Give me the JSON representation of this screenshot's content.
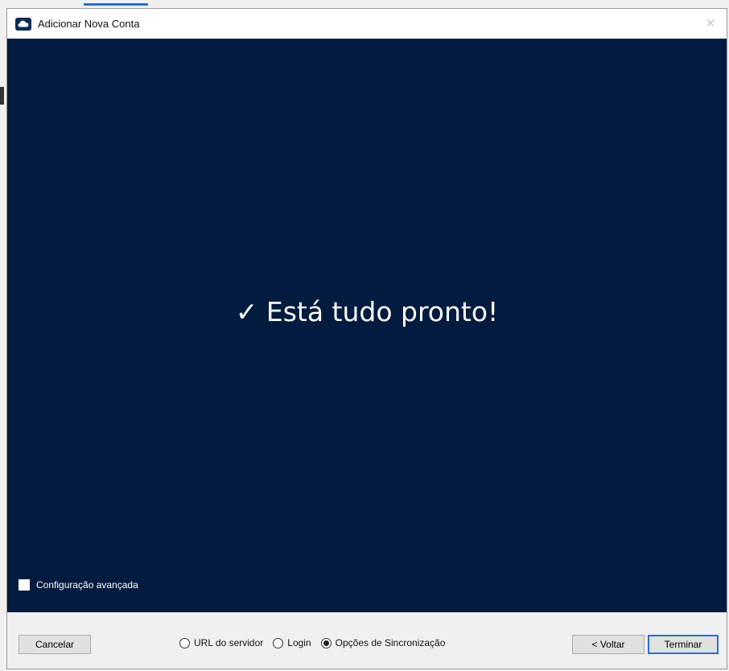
{
  "window": {
    "title": "Adicionar Nova Conta",
    "close_glyph": "✕"
  },
  "content": {
    "headline": "✓ Está tudo pronto!",
    "advanced_checkbox": {
      "label": "Configuração avançada",
      "checked": false
    }
  },
  "footer": {
    "cancel_label": "Cancelar",
    "steps": [
      {
        "label": "URL do servidor",
        "selected": false
      },
      {
        "label": "Login",
        "selected": false
      },
      {
        "label": "Opções de Sincronização",
        "selected": true
      }
    ],
    "back_label": "< Voltar",
    "finish_label": "Terminar"
  },
  "colors": {
    "content_background": "#021b3f",
    "accent": "#2f6dc4"
  },
  "icons": {
    "app": "cloud-icon",
    "close": "close-icon"
  }
}
